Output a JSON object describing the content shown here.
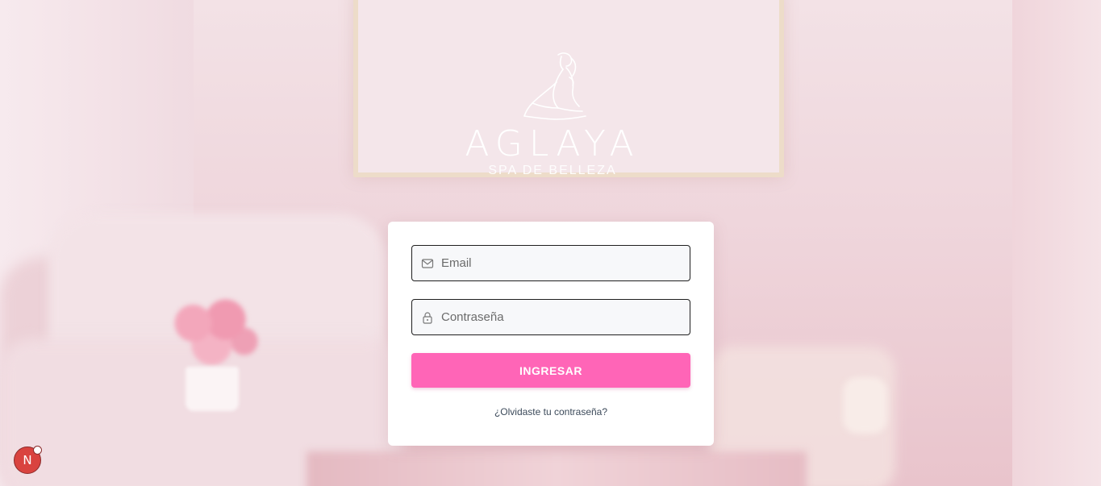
{
  "logo": {
    "brand": "AGLAYA",
    "tagline": "SPA DE BELLEZA"
  },
  "login": {
    "email_placeholder": "Email",
    "password_placeholder": "Contraseña",
    "submit_label": "INGRESAR",
    "forgot_link": "¿Olvidaste tu contraseña?"
  },
  "badge": {
    "letter": "N"
  },
  "colors": {
    "accent": "#ff65b7",
    "background": "#efd6dc",
    "card": "#ffffff",
    "badge": "#d9433f"
  },
  "icons": {
    "email_field": "mail-icon",
    "password_field": "lock-icon"
  }
}
